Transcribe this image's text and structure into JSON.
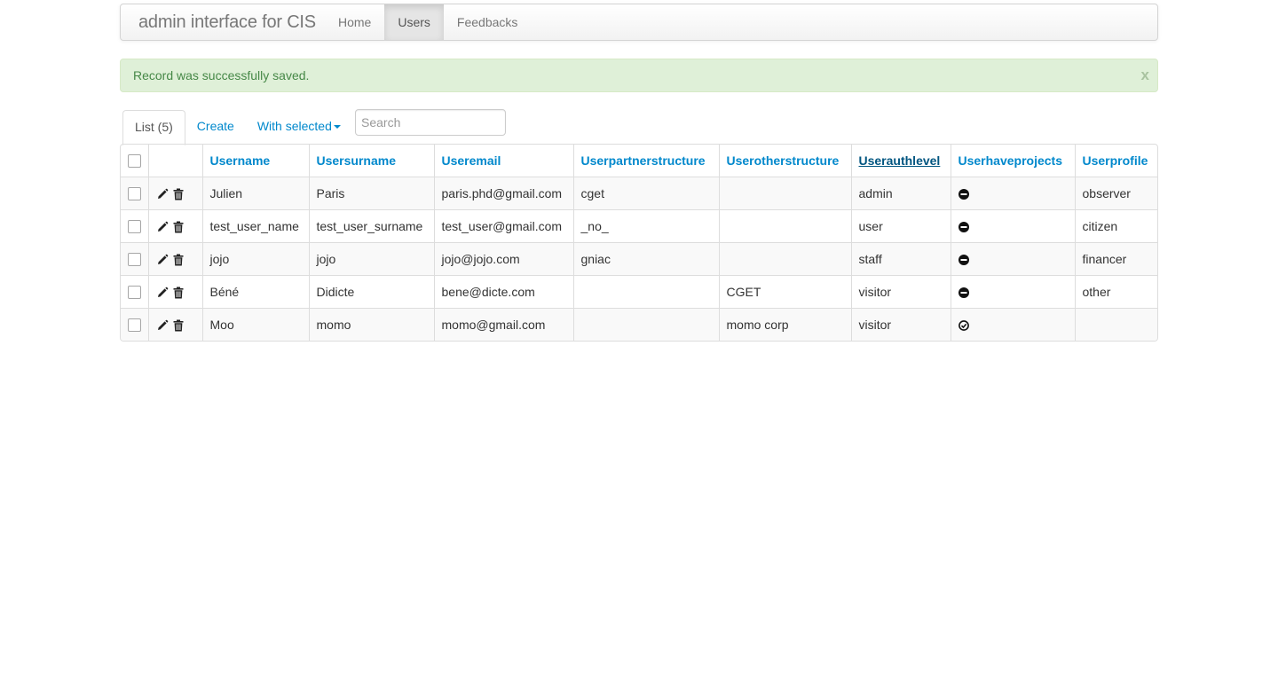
{
  "navbar": {
    "brand": "admin interface for CIS",
    "items": [
      {
        "label": "Home",
        "active": false
      },
      {
        "label": "Users",
        "active": true
      },
      {
        "label": "Feedbacks",
        "active": false
      }
    ]
  },
  "alert": {
    "message": "Record was successfully saved.",
    "close": "x"
  },
  "tabs": {
    "list": "List (5)",
    "create": "Create",
    "with_selected": "With selected"
  },
  "search": {
    "placeholder": "Search",
    "value": ""
  },
  "table": {
    "columns": [
      "Username",
      "Usersurname",
      "Useremail",
      "Userpartnerstructure",
      "Userotherstructure",
      "Userauthlevel",
      "Userhaveprojects",
      "Userprofile"
    ],
    "sorted_column": "Userauthlevel",
    "rows": [
      {
        "username": "Julien",
        "usersurname": "Paris",
        "useremail": "paris.phd@gmail.com",
        "userpartnerstructure": "cget",
        "userotherstructure": "",
        "userauthlevel": "admin",
        "userhaveprojects": "minus-circle-icon",
        "userprofile": "observer"
      },
      {
        "username": "test_user_name",
        "usersurname": "test_user_surname",
        "useremail": "test_user@gmail.com",
        "userpartnerstructure": "_no_",
        "userotherstructure": "",
        "userauthlevel": "user",
        "userhaveprojects": "minus-circle-icon",
        "userprofile": "citizen"
      },
      {
        "username": "jojo",
        "usersurname": "jojo",
        "useremail": "jojo@jojo.com",
        "userpartnerstructure": "gniac",
        "userotherstructure": "",
        "userauthlevel": "staff",
        "userhaveprojects": "minus-circle-icon",
        "userprofile": "financer"
      },
      {
        "username": "Béné",
        "usersurname": "Didicte",
        "useremail": "bene@dicte.com",
        "userpartnerstructure": "",
        "userotherstructure": "CGET",
        "userauthlevel": "visitor",
        "userhaveprojects": "minus-circle-icon",
        "userprofile": "other"
      },
      {
        "username": "Moo",
        "usersurname": "momo",
        "useremail": "momo@gmail.com",
        "userpartnerstructure": "",
        "userotherstructure": "momo corp",
        "userauthlevel": "visitor",
        "userhaveprojects": "check-circle-icon",
        "userprofile": ""
      }
    ]
  },
  "colors": {
    "link": "#0088cc",
    "alert_bg": "#dff0d8",
    "alert_text": "#468847"
  }
}
